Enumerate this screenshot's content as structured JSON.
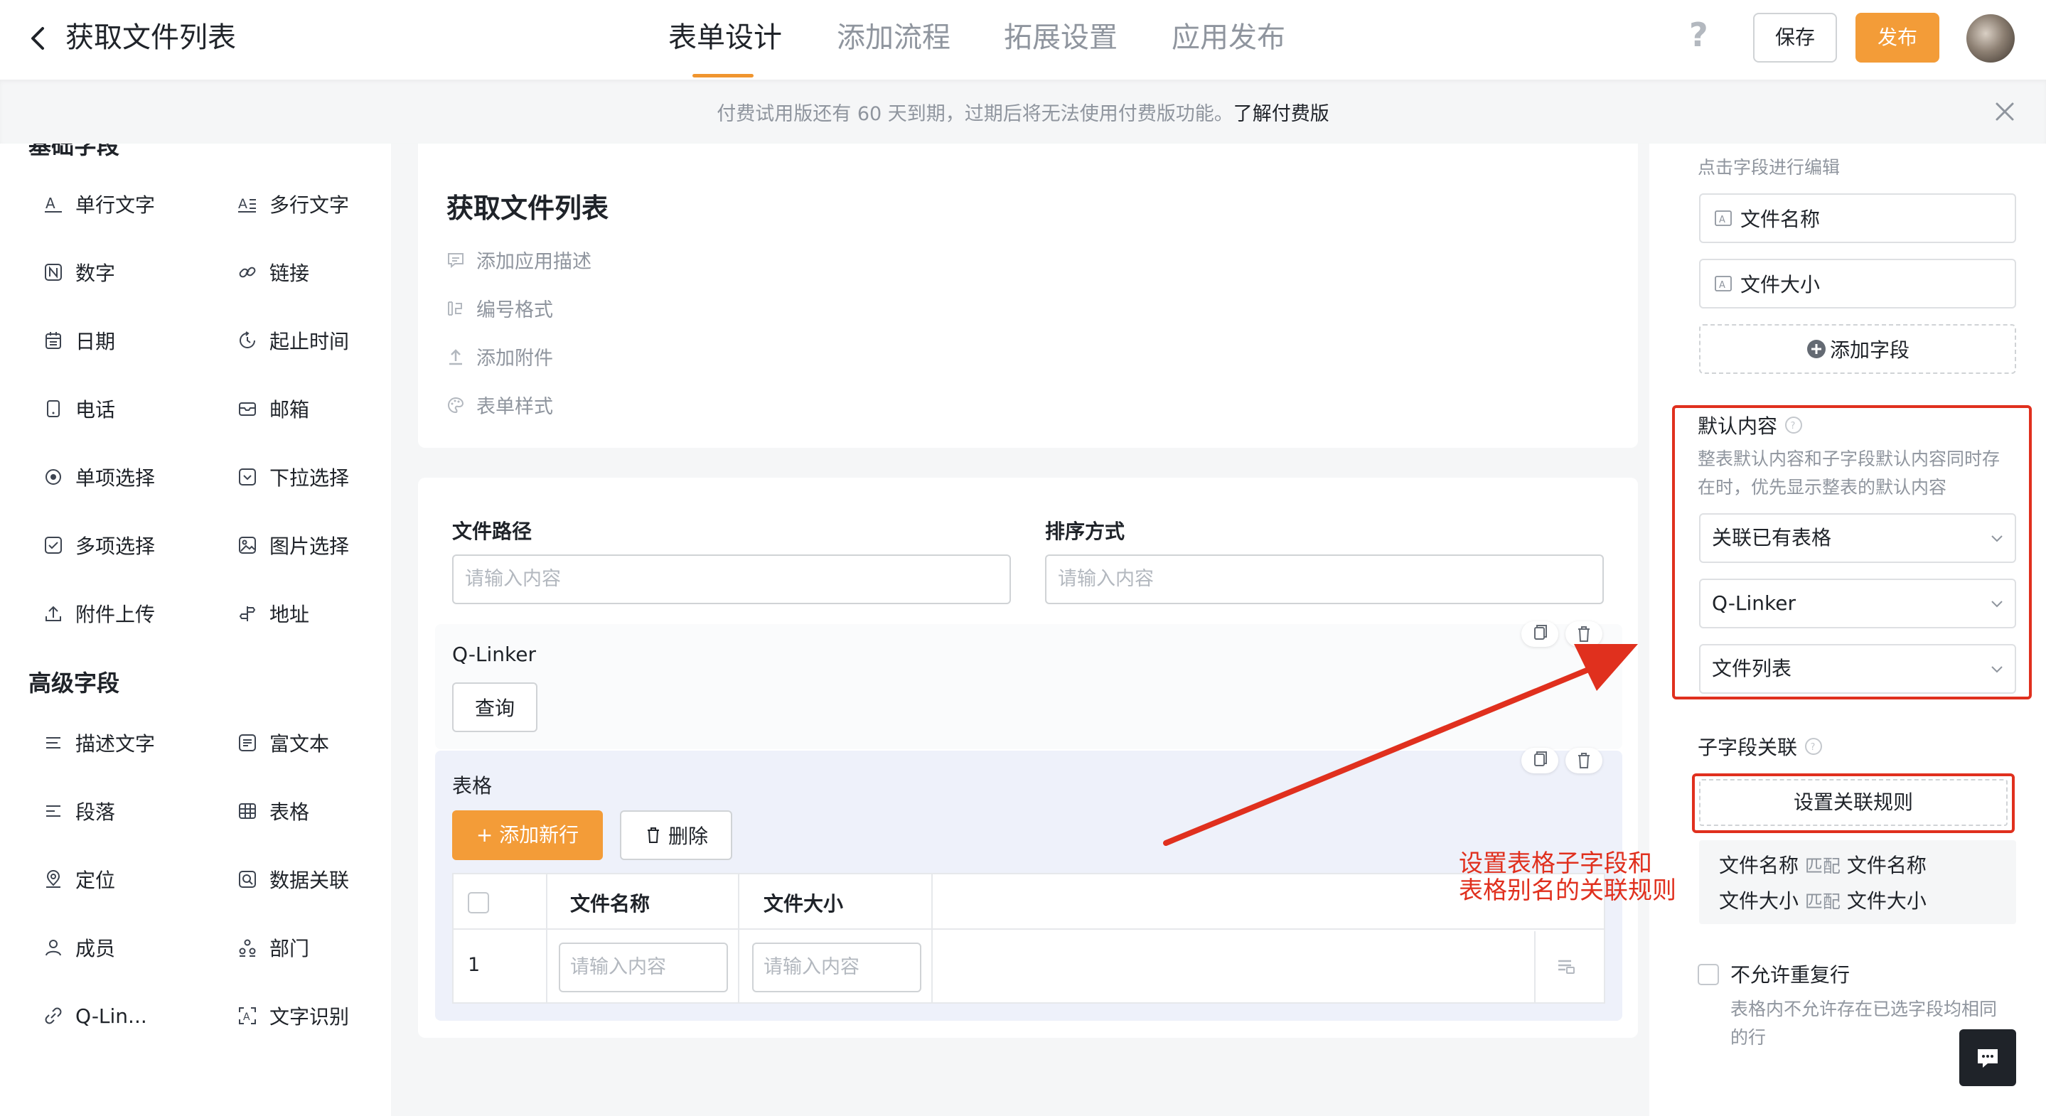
{
  "header": {
    "back_label": "<",
    "title": "获取文件列表",
    "tabs": [
      "表单设计",
      "添加流程",
      "拓展设置",
      "应用发布"
    ],
    "help": "?",
    "save_label": "保存",
    "publish_label": "发布"
  },
  "banner": {
    "text": "付费试用版还有 60 天到期，过期后将无法使用付费版功能。",
    "link": "了解付费版"
  },
  "left_panel": {
    "basic_title": "基础字段",
    "basic_fields": [
      {
        "label": "单行文字",
        "icon": "single-line-text-icon"
      },
      {
        "label": "多行文字",
        "icon": "multi-line-text-icon"
      },
      {
        "label": "数字",
        "icon": "number-icon"
      },
      {
        "label": "链接",
        "icon": "link-icon"
      },
      {
        "label": "日期",
        "icon": "date-icon"
      },
      {
        "label": "起止时间",
        "icon": "time-range-icon"
      },
      {
        "label": "电话",
        "icon": "phone-icon"
      },
      {
        "label": "邮箱",
        "icon": "mail-icon"
      },
      {
        "label": "单项选择",
        "icon": "radio-icon"
      },
      {
        "label": "下拉选择",
        "icon": "dropdown-icon"
      },
      {
        "label": "多项选择",
        "icon": "checkbox-icon"
      },
      {
        "label": "图片选择",
        "icon": "image-icon"
      },
      {
        "label": "附件上传",
        "icon": "upload-icon"
      },
      {
        "label": "地址",
        "icon": "address-icon"
      }
    ],
    "advanced_title": "高级字段",
    "advanced_fields": [
      {
        "label": "描述文字",
        "icon": "description-icon"
      },
      {
        "label": "富文本",
        "icon": "rich-text-icon"
      },
      {
        "label": "段落",
        "icon": "paragraph-icon"
      },
      {
        "label": "表格",
        "icon": "table-icon"
      },
      {
        "label": "定位",
        "icon": "location-icon"
      },
      {
        "label": "数据关联",
        "icon": "data-link-icon"
      },
      {
        "label": "成员",
        "icon": "member-icon"
      },
      {
        "label": "部门",
        "icon": "department-icon"
      },
      {
        "label": "Q-Lin...",
        "icon": "q-linker-icon"
      },
      {
        "label": "文字识别",
        "icon": "ocr-icon"
      }
    ]
  },
  "form": {
    "title": "获取文件列表",
    "meta": [
      {
        "label": "添加应用描述",
        "icon": "comment-icon"
      },
      {
        "label": "编号格式",
        "icon": "number-format-icon"
      },
      {
        "label": "添加附件",
        "icon": "attach-icon"
      },
      {
        "label": "表单样式",
        "icon": "palette-icon"
      }
    ],
    "fields": {
      "path_label": "文件路径",
      "path_placeholder": "请输入内容",
      "sort_label": "排序方式",
      "sort_placeholder": "请输入内容",
      "qlinker_label": "Q-Linker",
      "query_button": "查询",
      "table_label": "表格",
      "add_row": "+ 添加新行",
      "delete": "删除",
      "columns": [
        "文件名称",
        "文件大小"
      ],
      "row_index": "1",
      "cell_placeholder": "请输入内容"
    }
  },
  "right_panel": {
    "edit_hint": "点击字段进行编辑",
    "fields": [
      "文件名称",
      "文件大小"
    ],
    "add_field": "添加字段",
    "default_title": "默认内容",
    "default_hint_1": "整表默认内容和子字段默认内容同时存",
    "default_hint_2": "在时，优先显示整表的默认内容",
    "selects": [
      "关联已有表格",
      "Q-Linker",
      "文件列表"
    ],
    "sub_title": "子字段关联",
    "set_rule": "设置关联规则",
    "rules": [
      {
        "from": "文件名称",
        "op": "匹配",
        "to": "文件名称"
      },
      {
        "from": "文件大小",
        "op": "匹配",
        "to": "文件大小"
      }
    ],
    "no_dup": "不允许重复行",
    "no_dup_hint_1": "表格内不允许存在已选字段均相同",
    "no_dup_hint_2": "的行"
  },
  "annotation": {
    "line1": "设置表格子字段和",
    "line2": "表格别名的关联规则"
  },
  "colors": {
    "accent": "#f39c38",
    "annotation_red": "#e0301e"
  }
}
